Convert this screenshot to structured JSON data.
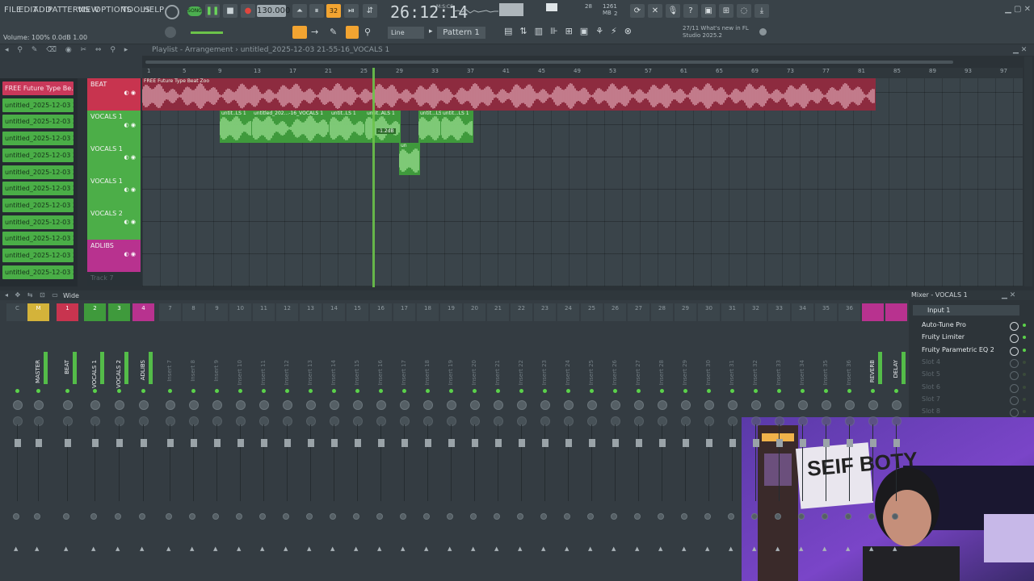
{
  "menu": [
    "FILE",
    "EDIT",
    "ADD",
    "PATTERNS",
    "VIEW",
    "OPTIONS",
    "TOOLS",
    "HELP"
  ],
  "transport": {
    "song_label": "SONG",
    "tempo": "130.000",
    "time": "26:12:14",
    "time_unit": "M:S:CS"
  },
  "monitor": {
    "cpu": "28",
    "memory": "1261 MB",
    "voices": "2"
  },
  "toolbar2": {
    "volume_readout": "Volume: 100% 0.0dB 1.00",
    "snap": "Line",
    "pattern": "Pattern 1",
    "news_line1": "27/11  What's new in FL",
    "news_line2": "Studio 2025.2"
  },
  "playlist": {
    "title": "Playlist - Arrangement",
    "breadcrumb": "untitled_2025-12-03 21-55-16_VOCALS 1",
    "ruler": [
      "1",
      "5",
      "9",
      "13",
      "17",
      "21",
      "25",
      "29",
      "33",
      "37",
      "41",
      "45",
      "49",
      "53",
      "57",
      "61",
      "65",
      "69",
      "73",
      "77",
      "81",
      "85",
      "89",
      "93",
      "97"
    ],
    "browser": [
      "FREE Future Type Be...",
      "untitled_2025-12-03 20-...",
      "untitled_2025-12-03 21-...",
      "untitled_2025-12-03 21-...",
      "untitled_2025-12-03 21-...",
      "untitled_2025-12-03 21-...",
      "untitled_2025-12-03 21-...",
      "untitled_2025-12-03 21-...",
      "untitled_2025-12-03 21-...",
      "untitled_2025-12-03 21-...",
      "untitled_2025-12-03 21-...",
      "untitled_2025-12-03 21-..."
    ],
    "tracks": [
      {
        "name": "BEAT",
        "color": "#c8344f"
      },
      {
        "name": "VOCALS 1",
        "color": "#4cae48"
      },
      {
        "name": "VOCALS 1",
        "color": "#4cae48"
      },
      {
        "name": "VOCALS 1",
        "color": "#4cae48"
      },
      {
        "name": "VOCALS 2",
        "color": "#4cae48"
      },
      {
        "name": "ADLIBS",
        "color": "#b8328f"
      },
      {
        "name": "Track 7",
        "color": "#3a444a"
      }
    ],
    "clips": {
      "beat": "FREE Future Type Beat Zoo",
      "voc_a": "untit..LS 1",
      "voc_b": "untitled_202...-16_VOCALS 1",
      "voc_c": "untit..LS 1",
      "voc_d": "untit..ALS 1",
      "voc_e": "untit...LS 1",
      "voc_f": "untit...LS 1",
      "voc_g": "unt",
      "voc_h": "un",
      "voc_badge": "-1.2dB"
    }
  },
  "mixer": {
    "wide_label": "Wide",
    "strips": [
      {
        "num": "C",
        "name": "",
        "hi": false
      },
      {
        "num": "M",
        "name": "MASTER",
        "hi": true
      },
      {
        "num": "1",
        "name": "BEAT",
        "hi": true
      },
      {
        "num": "2",
        "name": "VOCALS 1",
        "hi": true
      },
      {
        "num": "3",
        "name": "VOCALS 2",
        "hi": true
      },
      {
        "num": "4",
        "name": "ADLIBS",
        "hi": true
      },
      {
        "num": "7",
        "name": "Insert 7",
        "hi": false
      },
      {
        "num": "8",
        "name": "Insert 8",
        "hi": false
      },
      {
        "num": "9",
        "name": "Insert 9",
        "hi": false
      },
      {
        "num": "10",
        "name": "Insert 10",
        "hi": false
      },
      {
        "num": "11",
        "name": "Insert 11",
        "hi": false
      },
      {
        "num": "12",
        "name": "Insert 12",
        "hi": false
      },
      {
        "num": "13",
        "name": "Insert 13",
        "hi": false
      },
      {
        "num": "14",
        "name": "Insert 14",
        "hi": false
      },
      {
        "num": "15",
        "name": "Insert 15",
        "hi": false
      },
      {
        "num": "16",
        "name": "Insert 16",
        "hi": false
      },
      {
        "num": "17",
        "name": "Insert 17",
        "hi": false
      },
      {
        "num": "18",
        "name": "Insert 18",
        "hi": false
      },
      {
        "num": "19",
        "name": "Insert 19",
        "hi": false
      },
      {
        "num": "20",
        "name": "Insert 20",
        "hi": false
      },
      {
        "num": "21",
        "name": "Insert 21",
        "hi": false
      },
      {
        "num": "22",
        "name": "Insert 22",
        "hi": false
      },
      {
        "num": "23",
        "name": "Insert 23",
        "hi": false
      },
      {
        "num": "24",
        "name": "Insert 24",
        "hi": false
      },
      {
        "num": "25",
        "name": "Insert 25",
        "hi": false
      },
      {
        "num": "26",
        "name": "Insert 26",
        "hi": false
      },
      {
        "num": "27",
        "name": "Insert 27",
        "hi": false
      },
      {
        "num": "28",
        "name": "Insert 28",
        "hi": false
      },
      {
        "num": "29",
        "name": "Insert 29",
        "hi": false
      },
      {
        "num": "30",
        "name": "Insert 30",
        "hi": false
      },
      {
        "num": "31",
        "name": "Insert 31",
        "hi": false
      },
      {
        "num": "32",
        "name": "Insert 32",
        "hi": false
      },
      {
        "num": "33",
        "name": "Insert 33",
        "hi": false
      },
      {
        "num": "34",
        "name": "Insert 34",
        "hi": false
      },
      {
        "num": "35",
        "name": "Insert 35",
        "hi": false
      },
      {
        "num": "36",
        "name": "Insert 36",
        "hi": false
      },
      {
        "num": "",
        "name": "REVERB",
        "hi": true
      },
      {
        "num": "",
        "name": "DELAY",
        "hi": true
      }
    ],
    "panel": {
      "title": "Mixer - VOCALS 1",
      "input": "Input 1",
      "slots": [
        "Auto-Tune Pro",
        "Fruity Limiter",
        "Fruity Parametric EQ 2",
        "Slot 4",
        "Slot 5",
        "Slot 6",
        "Slot 7",
        "Slot 8"
      ]
    }
  },
  "webcam": {
    "poster_text": "SEIF BOTY"
  },
  "colors": {
    "accent_orange": "#f2a431",
    "beat_red": "#c8344f",
    "vocal_green": "#4cae48",
    "adlib_magenta": "#b8328f",
    "playhead_green": "#6cc34a"
  }
}
